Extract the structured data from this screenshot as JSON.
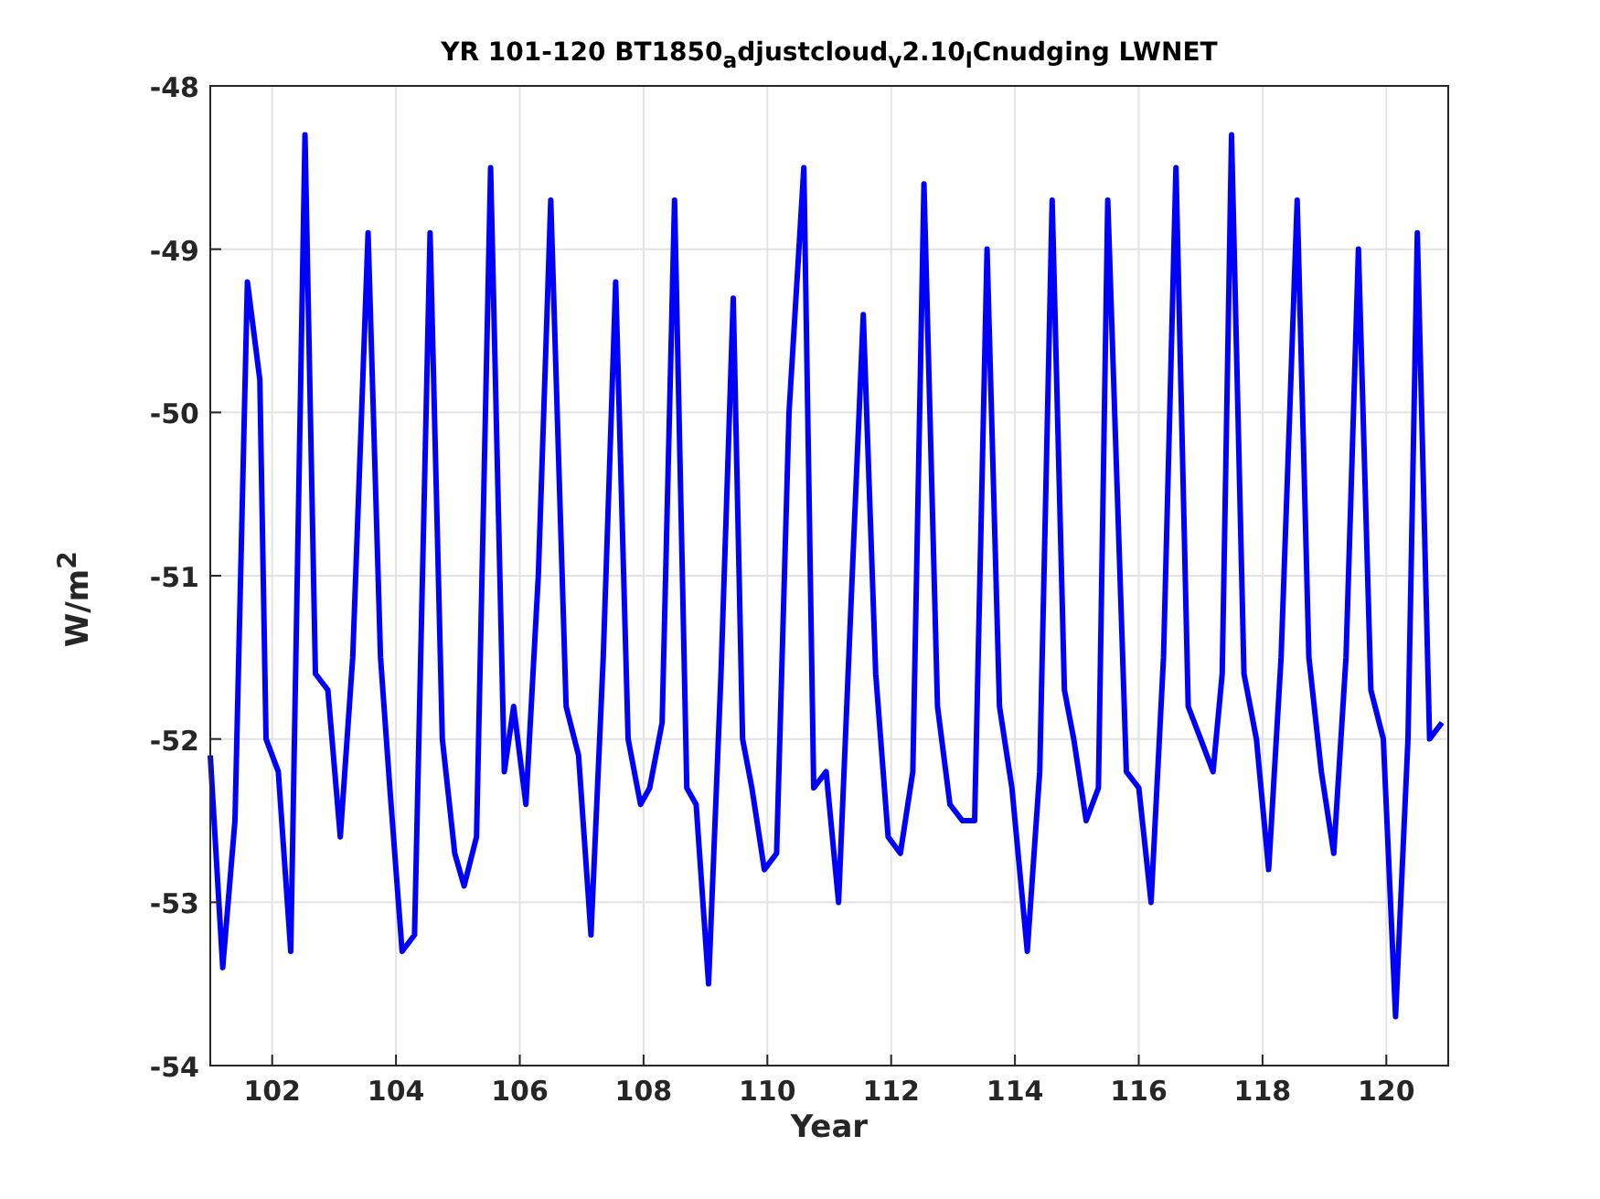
{
  "figure": {
    "chart_data": {
      "type": "line",
      "grid": true,
      "title": "YR 101-120 BT1850$_{a}$djustcloud$_{v}$2.10$_{l}$Cnudging LWNET",
      "xlabel": "Year",
      "ylabel": "W/m$^{2}$",
      "xlim": [
        101,
        121
      ],
      "ylim": [
        -54,
        -48
      ],
      "xticks": [
        102,
        104,
        106,
        108,
        110,
        112,
        114,
        116,
        118,
        120
      ],
      "yticks": [
        -54,
        -53,
        -52,
        -51,
        -50,
        -49,
        -48
      ],
      "x": [
        101.0,
        101.2,
        101.4,
        101.6,
        101.8,
        101.9,
        102.1,
        102.3,
        102.53,
        102.7,
        102.9,
        103.1,
        103.3,
        103.55,
        103.75,
        103.9,
        104.1,
        104.3,
        104.55,
        104.75,
        104.95,
        105.1,
        105.3,
        105.53,
        105.75,
        105.9,
        106.1,
        106.3,
        106.5,
        106.75,
        106.95,
        107.15,
        107.35,
        107.55,
        107.75,
        107.95,
        108.1,
        108.3,
        108.5,
        108.7,
        108.85,
        109.05,
        109.25,
        109.45,
        109.6,
        109.75,
        109.95,
        110.15,
        110.35,
        110.59,
        110.75,
        110.95,
        111.15,
        111.35,
        111.55,
        111.75,
        111.95,
        112.15,
        112.35,
        112.53,
        112.75,
        112.95,
        113.15,
        113.35,
        113.55,
        113.75,
        113.95,
        114.2,
        114.4,
        114.6,
        114.8,
        114.95,
        115.15,
        115.35,
        115.5,
        115.8,
        116.0,
        116.2,
        116.4,
        116.6,
        116.8,
        117.0,
        117.2,
        117.35,
        117.5,
        117.7,
        117.9,
        118.1,
        118.3,
        118.56,
        118.75,
        118.95,
        119.15,
        119.35,
        119.55,
        119.75,
        119.95,
        120.15,
        120.35,
        120.5,
        120.7,
        120.9
      ],
      "series": [
        {
          "color": "#0000ff",
          "values": [
            -52.1,
            -53.4,
            -52.5,
            -49.2,
            -49.8,
            -52.0,
            -52.2,
            -53.3,
            -48.3,
            -51.6,
            -51.7,
            -52.6,
            -51.5,
            -48.9,
            -51.5,
            -52.3,
            -53.3,
            -53.2,
            -48.9,
            -52.0,
            -52.7,
            -52.9,
            -52.6,
            -48.5,
            -52.2,
            -51.8,
            -52.4,
            -51.0,
            -48.7,
            -51.8,
            -52.1,
            -53.2,
            -51.5,
            -49.2,
            -52.0,
            -52.4,
            -52.3,
            -51.9,
            -48.7,
            -52.3,
            -52.4,
            -53.5,
            -51.6,
            -49.3,
            -52.0,
            -52.3,
            -52.8,
            -52.7,
            -50.0,
            -48.5,
            -52.3,
            -52.2,
            -53.0,
            -51.2,
            -49.4,
            -51.6,
            -52.6,
            -52.7,
            -52.2,
            -48.6,
            -51.8,
            -52.4,
            -52.5,
            -52.5,
            -49.0,
            -51.8,
            -52.3,
            -53.3,
            -52.2,
            -48.7,
            -51.7,
            -52.0,
            -52.5,
            -52.3,
            -48.7,
            -52.2,
            -52.3,
            -53.0,
            -51.5,
            -48.5,
            -51.8,
            -52.0,
            -52.2,
            -51.6,
            -48.3,
            -51.6,
            -52.0,
            -52.8,
            -51.5,
            -48.7,
            -51.5,
            -52.2,
            -52.7,
            -51.5,
            -49.0,
            -51.7,
            -52.0,
            -53.7,
            -52.0,
            -48.9,
            -52.0,
            -51.9
          ]
        }
      ]
    }
  }
}
